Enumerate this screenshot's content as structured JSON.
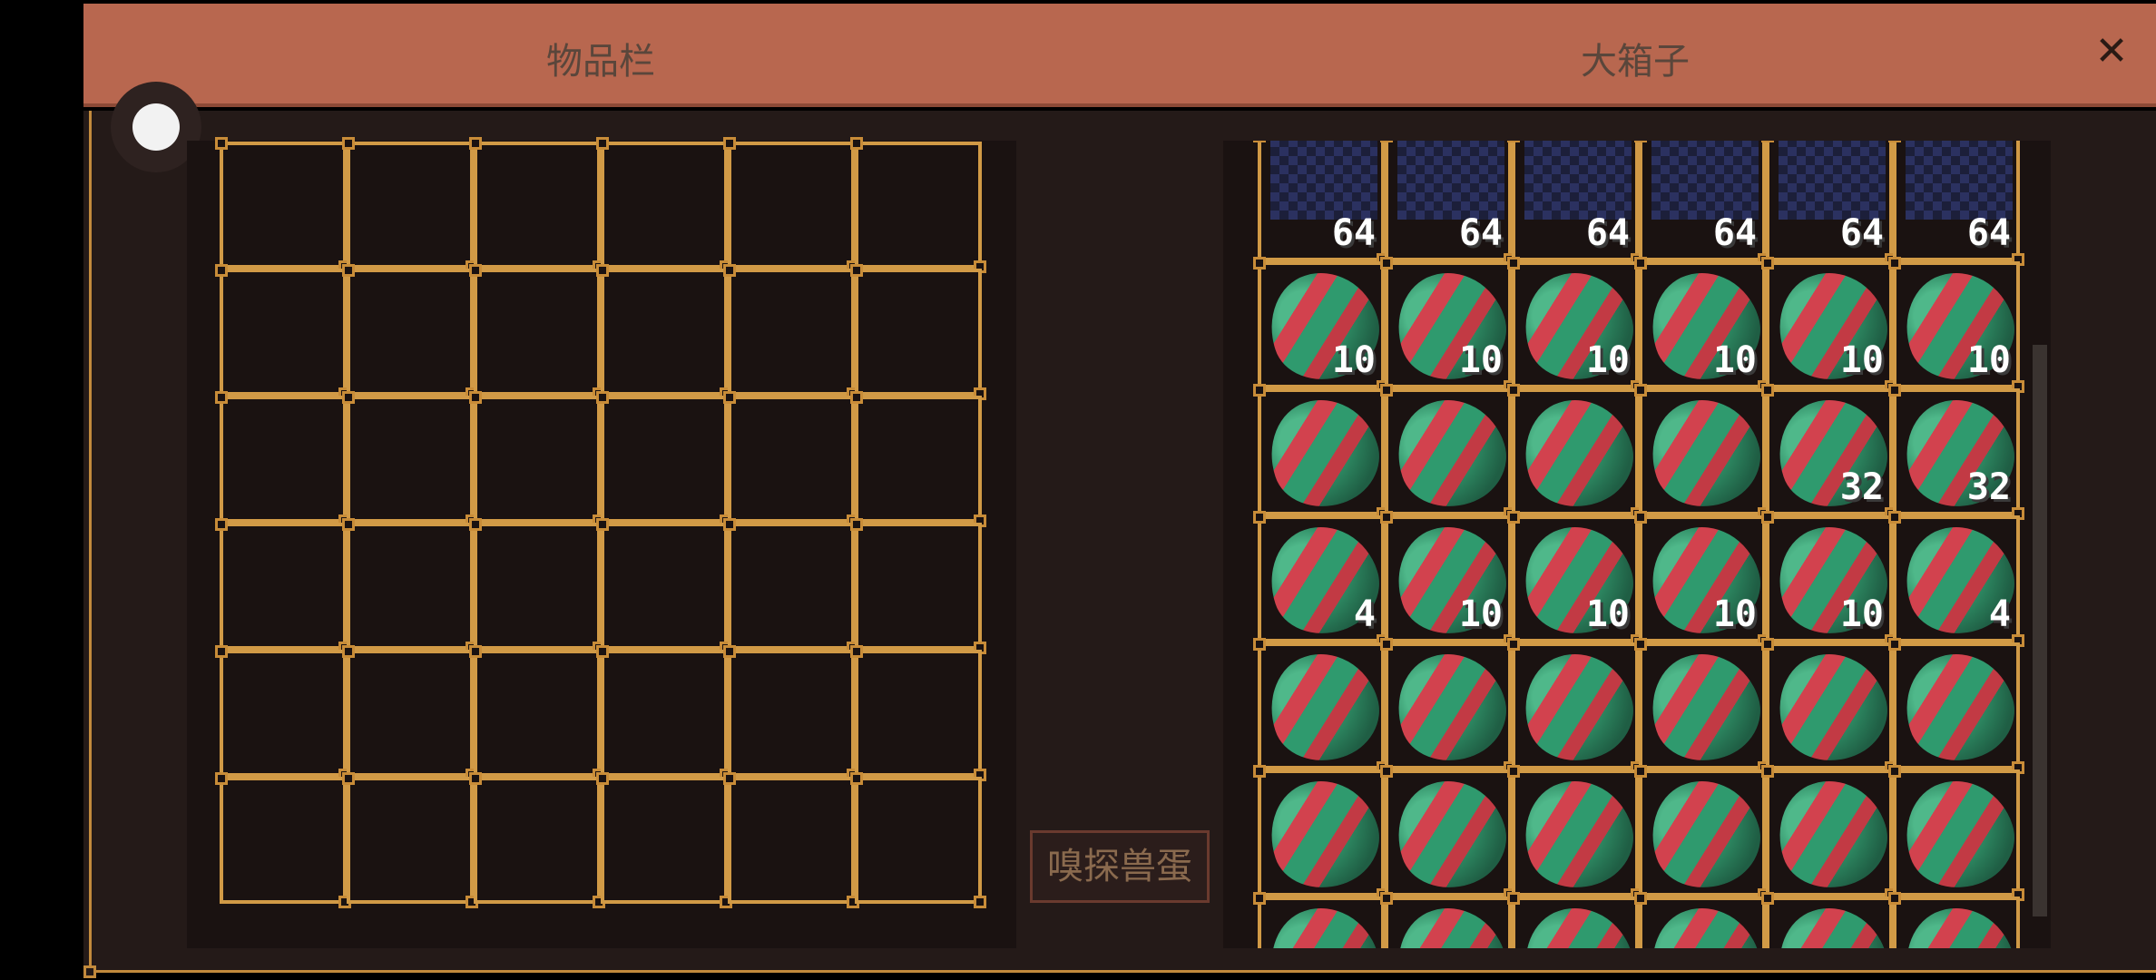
{
  "header": {
    "inventory_title": "物品栏",
    "chest_title": "大箱子",
    "close_label": "✕"
  },
  "sniff_button_label": "嗅探兽蛋",
  "inventory": {
    "rows": 6,
    "cols": 6,
    "slots": []
  },
  "chest": {
    "rows": [
      [
        {
          "item": "obsidian-icon",
          "count": "64"
        },
        {
          "item": "obsidian-icon",
          "count": "64"
        },
        {
          "item": "obsidian-icon",
          "count": "64"
        },
        {
          "item": "obsidian-icon",
          "count": "64"
        },
        {
          "item": "obsidian-icon",
          "count": "64"
        },
        {
          "item": "obsidian-icon",
          "count": "64"
        }
      ],
      [
        {
          "item": "egg-icon",
          "count": "10"
        },
        {
          "item": "egg-icon",
          "count": "10"
        },
        {
          "item": "egg-icon",
          "count": "10"
        },
        {
          "item": "egg-icon",
          "count": "10"
        },
        {
          "item": "egg-icon",
          "count": "10"
        },
        {
          "item": "egg-icon",
          "count": "10"
        }
      ],
      [
        {
          "item": "egg-icon",
          "count": ""
        },
        {
          "item": "egg-icon",
          "count": ""
        },
        {
          "item": "egg-icon",
          "count": ""
        },
        {
          "item": "egg-icon",
          "count": ""
        },
        {
          "item": "egg-icon",
          "count": "32"
        },
        {
          "item": "egg-icon",
          "count": "32"
        }
      ],
      [
        {
          "item": "egg-icon",
          "count": "4"
        },
        {
          "item": "egg-icon",
          "count": "10"
        },
        {
          "item": "egg-icon",
          "count": "10"
        },
        {
          "item": "egg-icon",
          "count": "10"
        },
        {
          "item": "egg-icon",
          "count": "10"
        },
        {
          "item": "egg-icon",
          "count": "4"
        }
      ],
      [
        {
          "item": "egg-icon",
          "count": ""
        },
        {
          "item": "egg-icon",
          "count": ""
        },
        {
          "item": "egg-icon",
          "count": ""
        },
        {
          "item": "egg-icon",
          "count": ""
        },
        {
          "item": "egg-icon",
          "count": ""
        },
        {
          "item": "egg-icon",
          "count": ""
        }
      ],
      [
        {
          "item": "egg-icon",
          "count": ""
        },
        {
          "item": "egg-icon",
          "count": ""
        },
        {
          "item": "egg-icon",
          "count": ""
        },
        {
          "item": "egg-icon",
          "count": ""
        },
        {
          "item": "egg-icon",
          "count": ""
        },
        {
          "item": "egg-icon",
          "count": ""
        }
      ],
      [
        {
          "item": "egg-icon",
          "count": ""
        },
        {
          "item": "egg-icon",
          "count": ""
        },
        {
          "item": "egg-icon",
          "count": ""
        },
        {
          "item": "egg-icon",
          "count": ""
        },
        {
          "item": "egg-icon",
          "count": ""
        },
        {
          "item": "egg-icon",
          "count": ""
        }
      ]
    ]
  },
  "colors": {
    "header_bg": "#b8674f",
    "panel_bg": "#241a18",
    "slot_border": "#d19a46"
  }
}
